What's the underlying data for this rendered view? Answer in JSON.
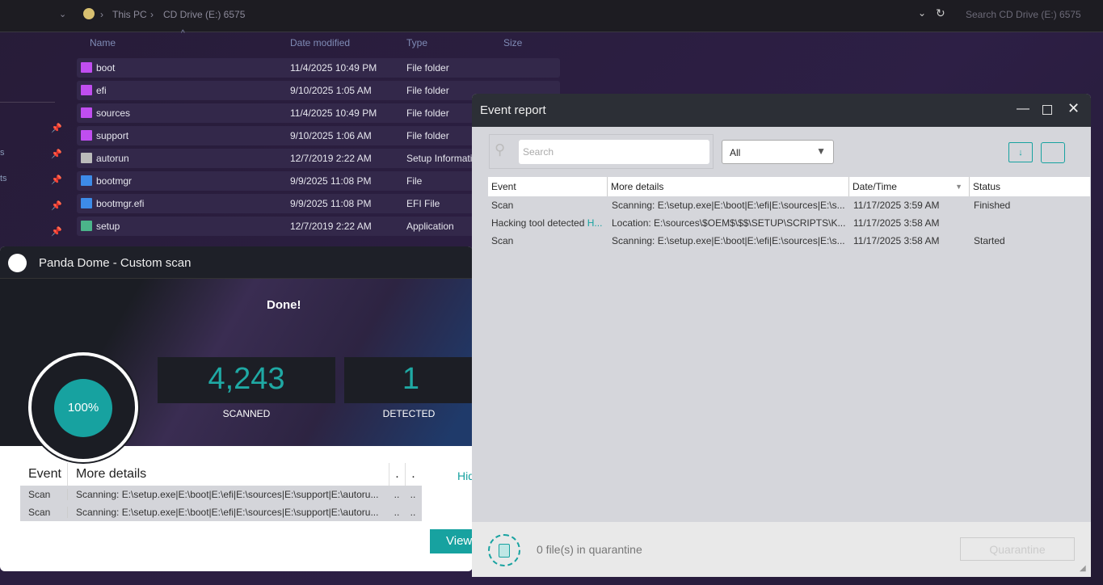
{
  "explorer": {
    "breadcrumb": [
      "This PC",
      "CD Drive (E:) 6575"
    ],
    "search_placeholder": "Search CD Drive (E:) 6575",
    "columns": [
      "Name",
      "Date modified",
      "Type",
      "Size"
    ],
    "files": [
      {
        "name": "boot",
        "date": "11/4/2025 10:49 PM",
        "type": "File folder",
        "icon": "folder-icon"
      },
      {
        "name": "efi",
        "date": "9/10/2025 1:05 AM",
        "type": "File folder",
        "icon": "folder-icon"
      },
      {
        "name": "sources",
        "date": "11/4/2025 10:49 PM",
        "type": "File folder",
        "icon": "folder-icon"
      },
      {
        "name": "support",
        "date": "9/10/2025 1:06 AM",
        "type": "File folder",
        "icon": "folder-icon"
      },
      {
        "name": "autorun",
        "date": "12/7/2019 2:22 AM",
        "type": "Setup Information",
        "icon": "settings-file-icon"
      },
      {
        "name": "bootmgr",
        "date": "9/9/2025 11:08 PM",
        "type": "File",
        "icon": "system-file-icon"
      },
      {
        "name": "bootmgr.efi",
        "date": "9/9/2025 11:08 PM",
        "type": "EFI File",
        "icon": "system-file-icon"
      },
      {
        "name": "setup",
        "date": "12/7/2019 2:22 AM",
        "type": "Application",
        "icon": "setup-app-icon"
      }
    ],
    "sidebar_fragments": [
      "s",
      "ts"
    ]
  },
  "panda": {
    "title": "Panda Dome - Custom scan",
    "status": "Done!",
    "progress": "100%",
    "scanned": "4,243",
    "scanned_label": "SCANNED",
    "detected": "1",
    "detected_label": "DETECTED",
    "table_headers": [
      "Event",
      "More details",
      ".",
      "."
    ],
    "rows": [
      {
        "event": "Scan",
        "details": "Scanning: E:\\setup.exe|E:\\boot|E:\\efi|E:\\sources|E:\\support|E:\\autoru...",
        "c3": "..",
        "c4": ".."
      },
      {
        "event": "Scan",
        "details": "Scanning: E:\\setup.exe|E:\\boot|E:\\efi|E:\\sources|E:\\support|E:\\autoru...",
        "c3": "..",
        "c4": ".."
      }
    ],
    "hide_link": "Hid",
    "view_button": "View"
  },
  "event_report": {
    "title": "Event report",
    "search_placeholder": "Search",
    "filter": "All",
    "columns": [
      "Event",
      "More details",
      "Date/Time",
      "Status"
    ],
    "rows": [
      {
        "event": "Scan",
        "event_link": "",
        "details": "Scanning: E:\\setup.exe|E:\\boot|E:\\efi|E:\\sources|E:\\s...",
        "date": "11/17/2025 3:59 AM",
        "status": "Finished"
      },
      {
        "event": "Hacking tool detected ",
        "event_link": "H...",
        "details": "Location: E:\\sources\\$OEM$\\$$\\SETUP\\SCRIPTS\\K...",
        "date": "11/17/2025 3:58 AM",
        "status": ""
      },
      {
        "event": "Scan",
        "event_link": "",
        "details": "Scanning: E:\\setup.exe|E:\\boot|E:\\efi|E:\\sources|E:\\s...",
        "date": "11/17/2025 3:58 AM",
        "status": "Started"
      }
    ],
    "quarantine_count": "0 file(s) in quarantine",
    "quarantine_button": "Quarantine"
  },
  "colors": {
    "accent": "#17a2a0",
    "folder": "#c04ef0"
  }
}
